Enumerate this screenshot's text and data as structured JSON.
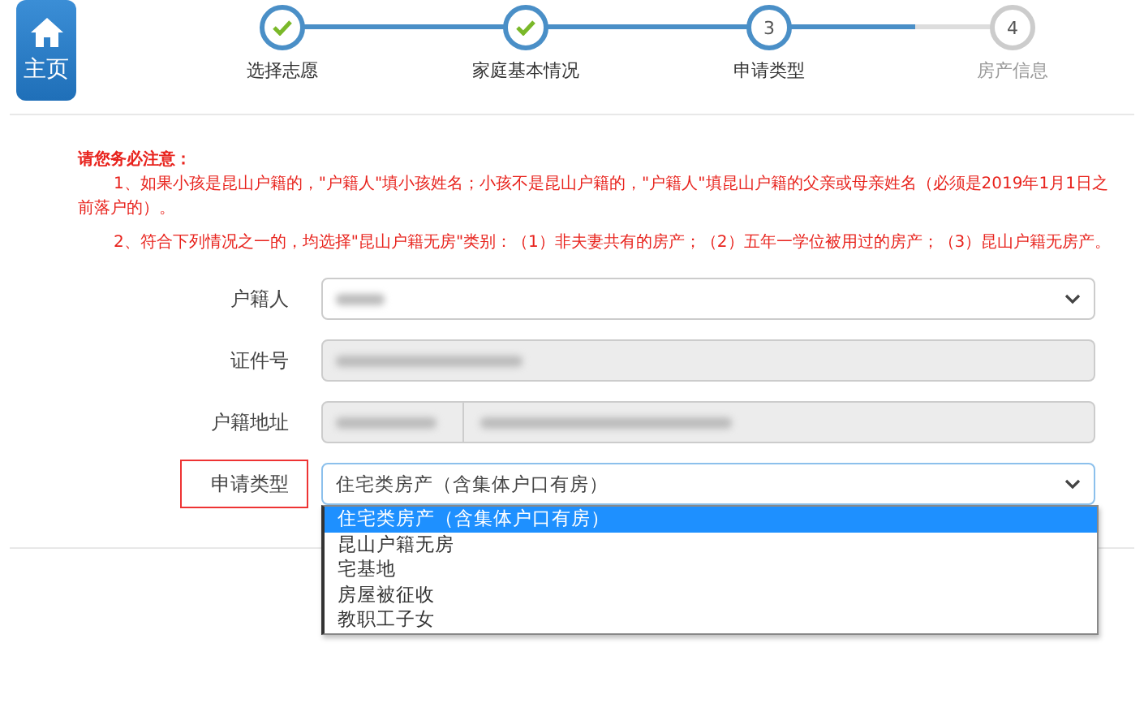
{
  "home_button": {
    "label": "主页"
  },
  "steps": [
    {
      "label": "选择志愿",
      "completed": true,
      "reached": true
    },
    {
      "label": "家庭基本情况",
      "completed": true,
      "reached": true
    },
    {
      "number": "3",
      "label": "申请类型",
      "completed": false,
      "reached": true
    },
    {
      "number": "4",
      "label": "房产信息",
      "completed": false,
      "reached": false
    }
  ],
  "notice": {
    "title": "请您务必注意：",
    "paragraphs": [
      "1、如果小孩是昆山户籍的，\"户籍人\"填小孩姓名；小孩不是昆山户籍的，\"户籍人\"填昆山户籍的父亲或母亲姓名（必须是2019年1月1日之前落户的）。",
      "2、符合下列情况之一的，均选择\"昆山户籍无房\"类别：（1）非夫妻共有的房产；（2）五年一学位被用过的房产；（3）昆山户籍无房产。"
    ]
  },
  "form": [
    {
      "label": "户籍人",
      "kind": "select",
      "highlighted": false,
      "redacted": true
    },
    {
      "label": "证件号",
      "kind": "readonly",
      "highlighted": false,
      "redacted": true
    },
    {
      "label": "户籍地址",
      "kind": "split",
      "highlighted": false,
      "redacted": true
    },
    {
      "label": "申请类型",
      "kind": "select",
      "highlighted": true,
      "value": "住宅类房产（含集体户口有房）",
      "options": [
        {
          "label": "住宅类房产（含集体户口有房）",
          "selected": true
        },
        {
          "label": "昆山户籍无房",
          "selected": false
        },
        {
          "label": "宅基地",
          "selected": false
        },
        {
          "label": "房屋被征收",
          "selected": false
        },
        {
          "label": "教职工子女",
          "selected": false
        }
      ]
    }
  ]
}
